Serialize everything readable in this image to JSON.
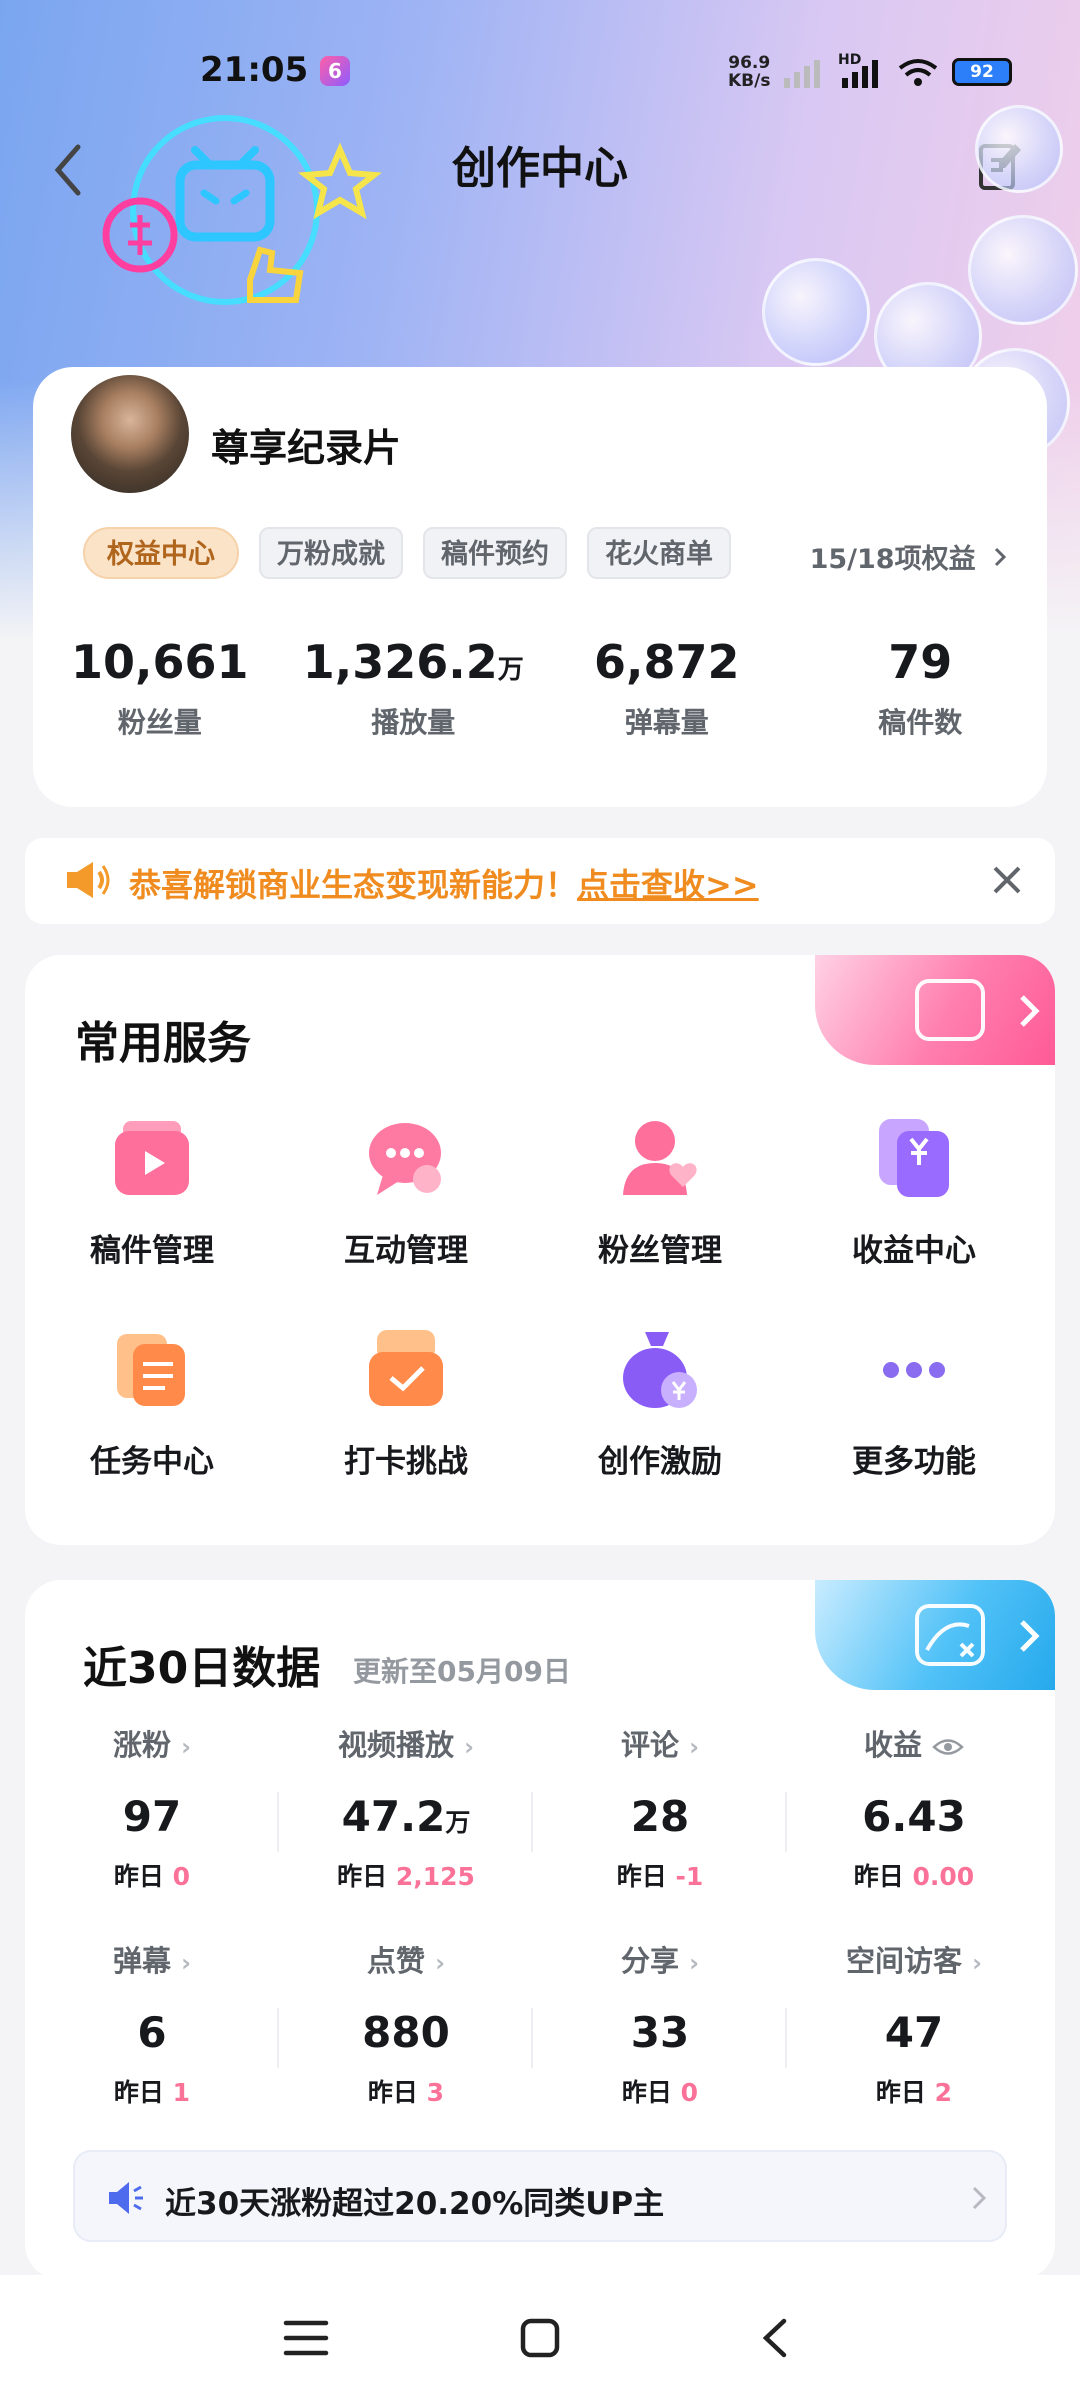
{
  "status_bar": {
    "time": "21:05",
    "app_badge": "6",
    "net_speed_value": "96.9",
    "net_speed_unit": "KB/s",
    "network_type": "HD",
    "battery": "92"
  },
  "header": {
    "title": "创作中心"
  },
  "profile": {
    "name": "尊享纪录片",
    "tags": [
      "权益中心",
      "万粉成就",
      "稿件预约",
      "花火商单"
    ],
    "rights_link": "15/18项权益",
    "stats": [
      {
        "value": "10,661",
        "unit": "",
        "label": "粉丝量"
      },
      {
        "value": "1,326.2",
        "unit": "万",
        "label": "播放量"
      },
      {
        "value": "6,872",
        "unit": "",
        "label": "弹幕量"
      },
      {
        "value": "79",
        "unit": "",
        "label": "稿件数"
      }
    ]
  },
  "notice": {
    "text": "恭喜解锁商业生态变现新能力！",
    "link": "点击查收>>"
  },
  "services": {
    "title": "常用服务",
    "items": [
      {
        "label": "稿件管理",
        "icon": "manuscript-icon"
      },
      {
        "label": "互动管理",
        "icon": "chat-bubble-icon"
      },
      {
        "label": "粉丝管理",
        "icon": "fans-icon"
      },
      {
        "label": "收益中心",
        "icon": "wallet-icon"
      },
      {
        "label": "任务中心",
        "icon": "task-list-icon"
      },
      {
        "label": "打卡挑战",
        "icon": "checkin-icon"
      },
      {
        "label": "创作激励",
        "icon": "money-bag-icon"
      },
      {
        "label": "更多功能",
        "icon": "more-dots-icon"
      }
    ]
  },
  "data_panel": {
    "title": "近30日数据",
    "subtitle": "更新至05月09日",
    "yesterday_label": "昨日",
    "metrics": [
      {
        "name": "涨粉",
        "value": "97",
        "unit": "",
        "yesterday": "0"
      },
      {
        "name": "视频播放",
        "value": "47.2",
        "unit": "万",
        "yesterday": "2,125"
      },
      {
        "name": "评论",
        "value": "28",
        "unit": "",
        "yesterday": "-1"
      },
      {
        "name": "收益",
        "value": "6.43",
        "unit": "",
        "yesterday": "0.00"
      },
      {
        "name": "弹幕",
        "value": "6",
        "unit": "",
        "yesterday": "1"
      },
      {
        "name": "点赞",
        "value": "880",
        "unit": "",
        "yesterday": "3"
      },
      {
        "name": "分享",
        "value": "33",
        "unit": "",
        "yesterday": "0"
      },
      {
        "name": "空间访客",
        "value": "47",
        "unit": "",
        "yesterday": "2"
      }
    ],
    "tip": "近30天涨粉超过20.20%同类UP主"
  },
  "colors": {
    "accent_pink": "#fb7299",
    "notice_orange": "#f08c1f",
    "header_blue": "#7aa6f0"
  }
}
